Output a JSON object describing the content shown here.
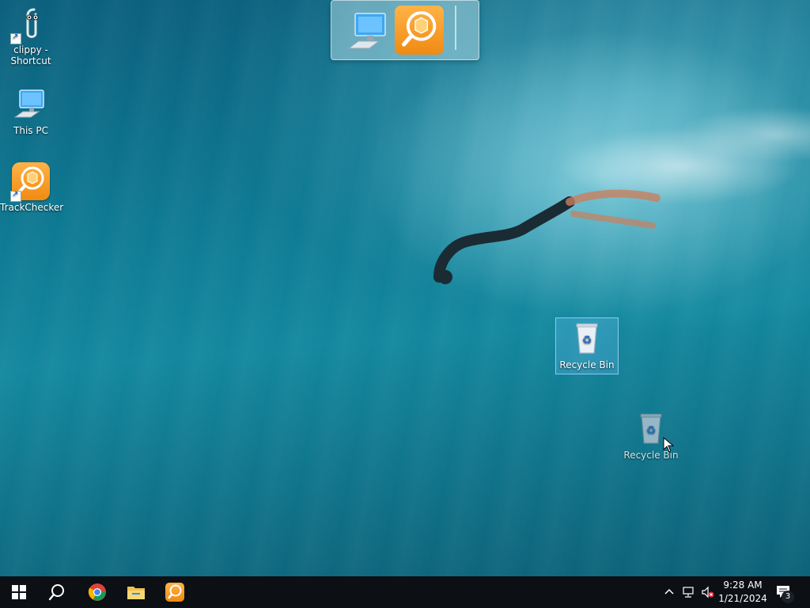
{
  "desktop": {
    "icons": [
      {
        "label": "clippy - Shortcut",
        "icon": "paperclip-icon"
      },
      {
        "label": "This PC",
        "icon": "computer-icon"
      },
      {
        "label": "TrackChecker",
        "icon": "trackchecker-icon"
      },
      {
        "label": "Recycle Bin",
        "icon": "recycle-bin-icon",
        "selected": true
      },
      {
        "label": "Recycle Bin",
        "icon": "recycle-bin-icon",
        "dragging": true
      }
    ]
  },
  "task_switcher": {
    "items": [
      {
        "icon": "computer-icon"
      },
      {
        "icon": "trackchecker-icon",
        "active": true
      }
    ]
  },
  "taskbar": {
    "buttons": [
      {
        "icon": "windows-start-icon"
      },
      {
        "icon": "search-icon"
      },
      {
        "icon": "chrome-icon"
      },
      {
        "icon": "file-explorer-icon"
      },
      {
        "icon": "trackchecker-icon"
      }
    ],
    "tray": {
      "icons": [
        "chevron-up-icon",
        "network-icon",
        "volume-muted-icon"
      ],
      "time": "9:28 AM",
      "date": "1/21/2024",
      "notification_count": "3"
    }
  },
  "colors": {
    "taskbar": "#0c0f14",
    "accent_orange": "#f08a12",
    "water": "#0e7a93"
  }
}
